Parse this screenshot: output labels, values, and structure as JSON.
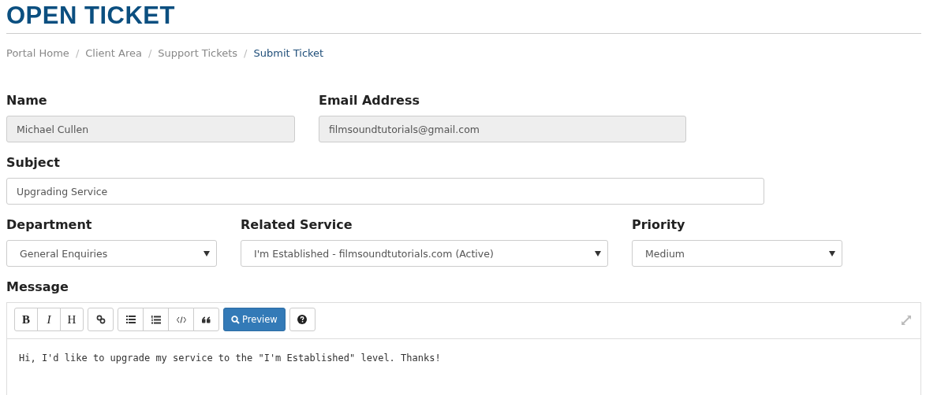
{
  "title": "OPEN TICKET",
  "breadcrumb": [
    {
      "label": "Portal Home",
      "current": false
    },
    {
      "label": "Client Area",
      "current": false
    },
    {
      "label": "Support Tickets",
      "current": false
    },
    {
      "label": "Submit Ticket",
      "current": true
    }
  ],
  "separator": "/",
  "name": {
    "label": "Name",
    "value": "Michael Cullen",
    "disabled": true
  },
  "email": {
    "label": "Email Address",
    "value": "filmsoundtutorials@gmail.com",
    "disabled": true
  },
  "subject": {
    "label": "Subject",
    "value": "Upgrading Service"
  },
  "department": {
    "label": "Department",
    "value": "General Enquiries"
  },
  "related_service": {
    "label": "Related Service",
    "value": "I'm Established - filmsoundtutorials.com (Active)"
  },
  "priority": {
    "label": "Priority",
    "value": "Medium"
  },
  "message": {
    "label": "Message",
    "toolbar": [
      [
        {
          "kind": "bold",
          "label": "B"
        },
        {
          "kind": "italic",
          "label": "I"
        },
        {
          "kind": "heading",
          "label": "H"
        }
      ],
      [
        {
          "kind": "link"
        }
      ],
      [
        {
          "kind": "bullets"
        },
        {
          "kind": "numbers"
        },
        {
          "kind": "code"
        },
        {
          "kind": "quote"
        }
      ],
      [
        {
          "kind": "preview",
          "label": "Preview"
        }
      ],
      [
        {
          "kind": "help"
        }
      ]
    ],
    "value": "Hi, I'd like to upgrade my service to the \"I'm Established\" level. Thanks!"
  }
}
